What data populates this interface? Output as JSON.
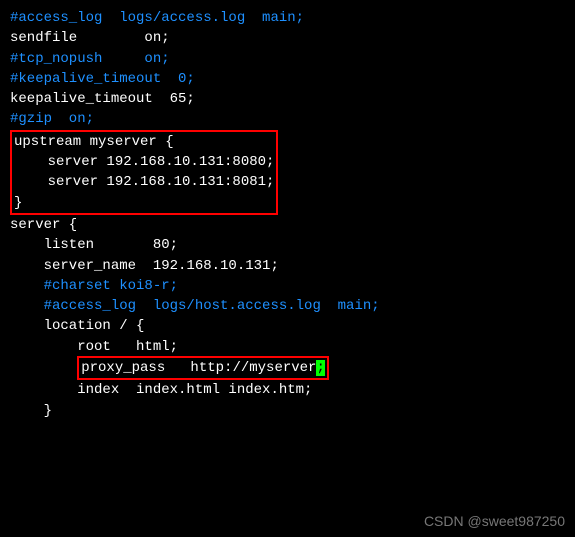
{
  "lines": {
    "l1": "#access_log  logs/access.log  main;",
    "l2": "",
    "l3a": "sendfile        on;",
    "l4": "#tcp_nopush     on;",
    "l5": "",
    "l6": "#keepalive_timeout  0;",
    "l7a": "keepalive_timeout  65;",
    "l8": "",
    "l9": "#gzip  on;",
    "u1": "upstream myserver {",
    "u2": "    server 192.168.10.131:8080;",
    "u3": "    server 192.168.10.131:8081;",
    "u4": "}",
    "s1": "",
    "s2": "server {",
    "s3": "    listen       80;",
    "s4": "    server_name  192.168.10.131;",
    "s5": "",
    "s6": "    #charset koi8-r;",
    "s7": "",
    "s8": "    #access_log  logs/host.access.log  main;",
    "s9": "",
    "s10": "    location / {",
    "s11": "        root   html;",
    "px_indent": "        ",
    "px_text": "proxy_pass   http://myserver",
    "px_cursor": ";",
    "s13": "        index  index.html index.htm;",
    "s14": "    }"
  },
  "watermark": "CSDN @sweet987250"
}
